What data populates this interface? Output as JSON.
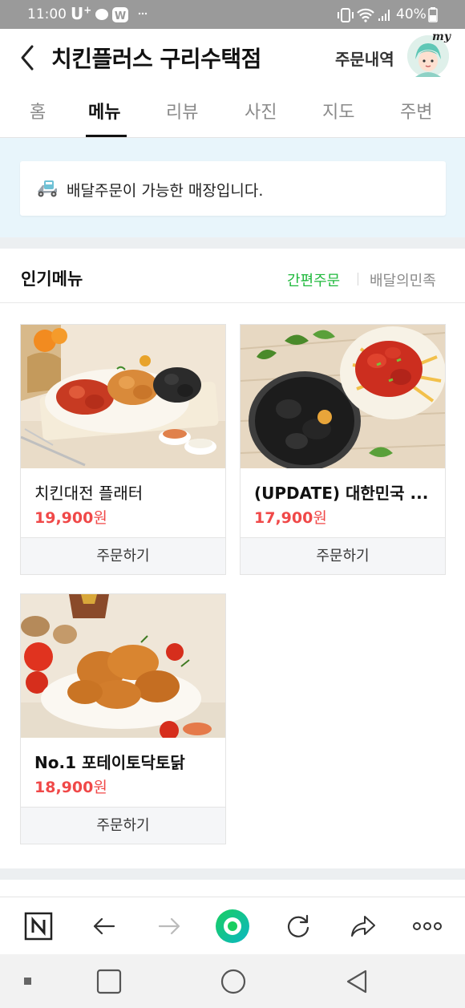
{
  "status_bar": {
    "time": "11:00",
    "carrier": "U",
    "carrier_sup": "+",
    "battery": "40%"
  },
  "header": {
    "title": "치킨플러스 구리수택점",
    "order_history": "주문내역",
    "avatar_badge": "my"
  },
  "tabs": [
    {
      "label": "홈"
    },
    {
      "label": "메뉴",
      "active": true
    },
    {
      "label": "리뷰"
    },
    {
      "label": "사진"
    },
    {
      "label": "지도"
    },
    {
      "label": "주변"
    }
  ],
  "notice": {
    "text": "배달주문이 가능한 매장입니다.",
    "icon": "delivery-scooter-icon"
  },
  "popular": {
    "title": "인기메뉴",
    "quick_order": "간편주문",
    "baemin": "배달의민족"
  },
  "menu_items": [
    {
      "name": "치킨대전 플래터",
      "price": "19,900",
      "currency": "원",
      "order_label": "주문하기"
    },
    {
      "name": "(UPDATE) 대한민국 ...",
      "price": "17,900",
      "currency": "원",
      "order_label": "주문하기"
    },
    {
      "name": "No.1 포테이토닥토닭",
      "price": "18,900",
      "currency": "원",
      "order_label": "주문하기"
    }
  ],
  "colors": {
    "accent_green": "#1fb93c",
    "price_red": "#f04848",
    "notice_bg": "#e8f5fb",
    "naver_green": "#19ce60"
  },
  "browser_toolbar": [
    "naver-home-icon",
    "back-arrow-icon",
    "forward-arrow-icon",
    "green-dot-icon",
    "refresh-icon",
    "share-icon",
    "more-icon"
  ],
  "android_nav": [
    "recent-apps-icon",
    "home-icon",
    "back-icon"
  ]
}
